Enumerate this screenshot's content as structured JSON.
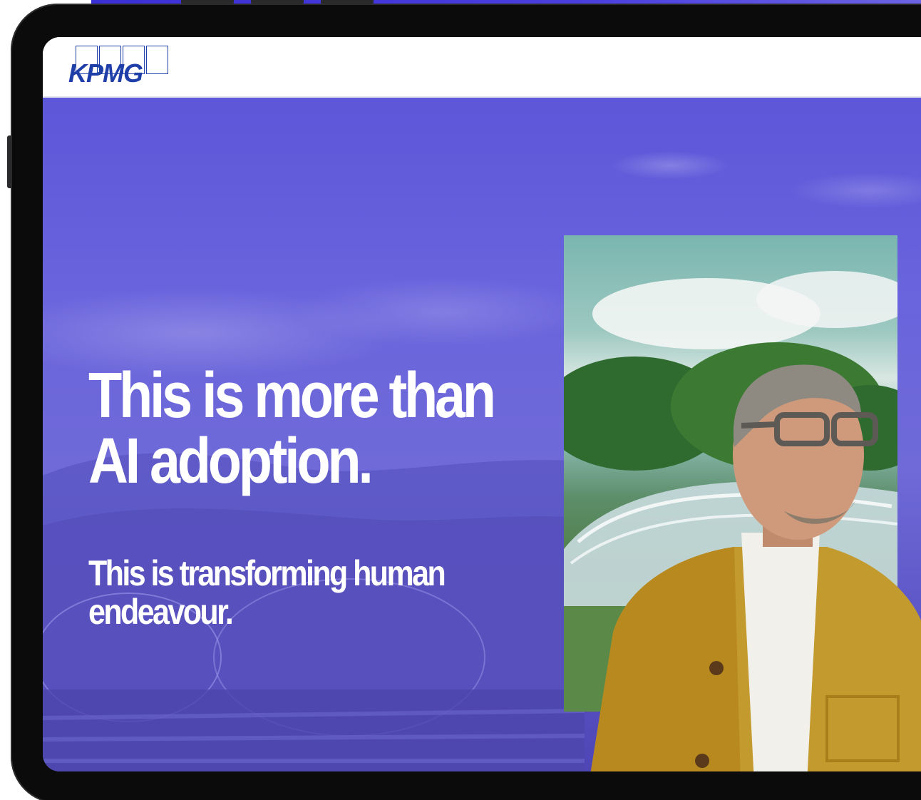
{
  "brand": {
    "logo_text": "KPMG",
    "logo_color": "#1e3fa8"
  },
  "hero": {
    "headline_line1": "This is more than",
    "headline_line2": "AI adoption.",
    "subheadline_line1": "This is transforming human",
    "subheadline_line2": "endeavour.",
    "overlay_color": "#5d57d9",
    "text_color": "#ffffff"
  },
  "icons": {
    "logo": "kpmg-logo-icon"
  }
}
